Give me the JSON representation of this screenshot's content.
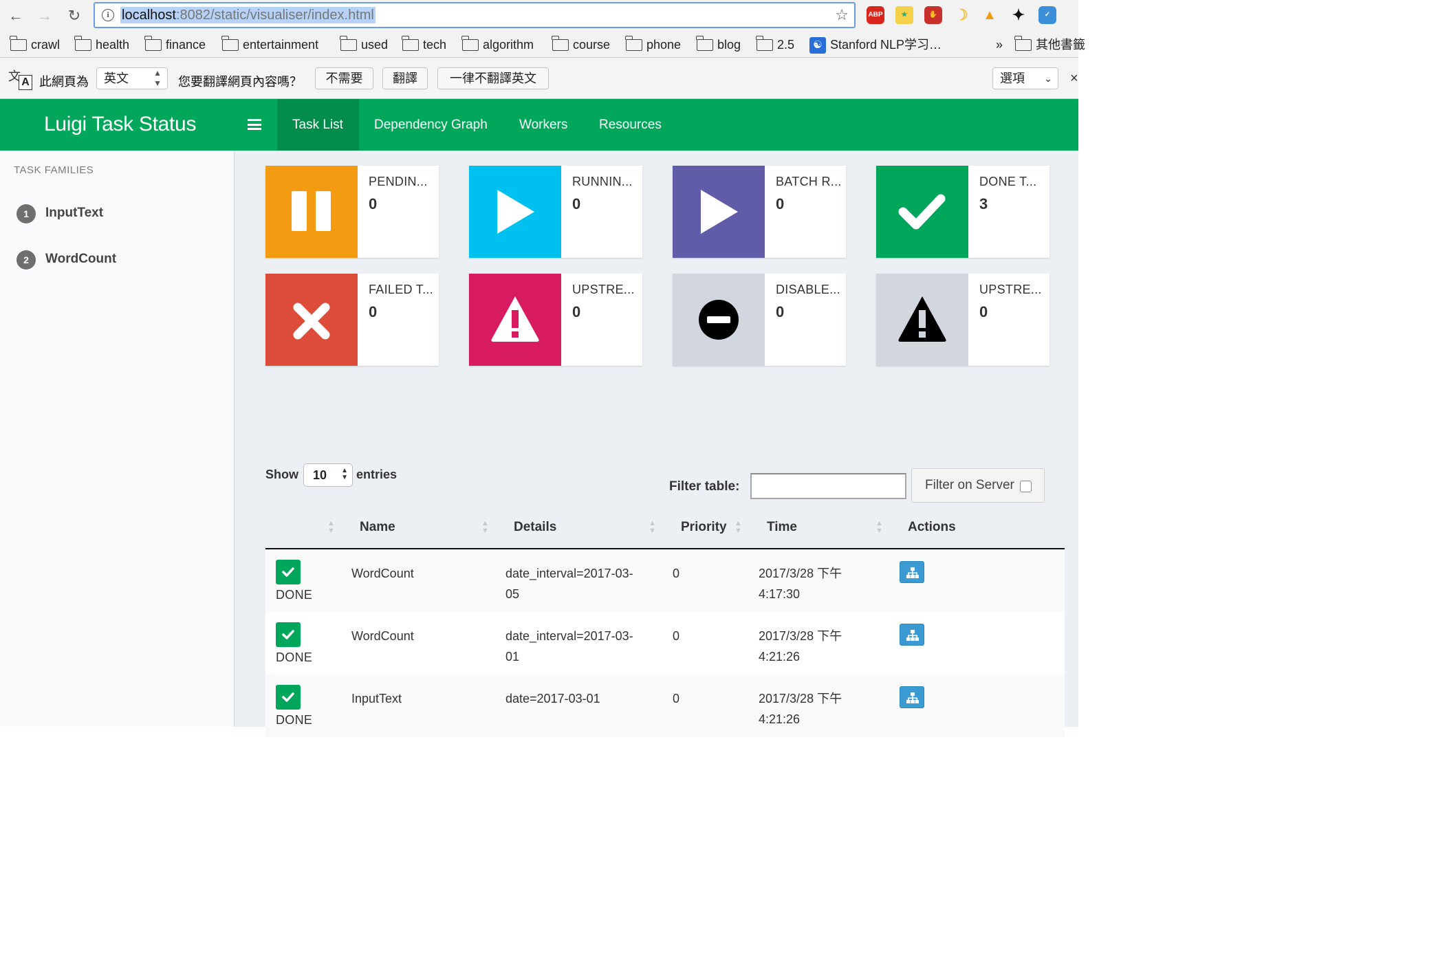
{
  "browser": {
    "url_host": "localhost",
    "url_rest": ":8082/static/visualiser/index.html",
    "bookmarks": [
      "crawl",
      "health",
      "finance",
      "entertainment",
      "used",
      "tech",
      "algorithm",
      "course",
      "phone",
      "blog",
      "2.5",
      "Stanford NLP学习…",
      "其他書籤"
    ],
    "overflow": "»",
    "extensions": [
      "ABP"
    ]
  },
  "translate": {
    "prefix": "此網頁為",
    "language": "英文",
    "question": "您要翻譯網頁內容嗎？",
    "no": "不需要",
    "translate": "翻譯",
    "never": "一律不翻譯英文",
    "options": "選項"
  },
  "app": {
    "brand": "Luigi Task Status",
    "nav": [
      "Task List",
      "Dependency Graph",
      "Workers",
      "Resources"
    ],
    "active_nav": "Task List",
    "accent": "#00a65a"
  },
  "sidebar": {
    "heading": "TASK FAMILIES",
    "families": [
      {
        "num": "1",
        "name": "InputText"
      },
      {
        "num": "2",
        "name": "WordCount"
      }
    ]
  },
  "status_boxes": [
    {
      "label": "PENDIN...",
      "count": "0",
      "color": "#f39c12",
      "icon": "pause-icon"
    },
    {
      "label": "RUNNIN...",
      "count": "0",
      "color": "#00c0ef",
      "icon": "play-icon"
    },
    {
      "label": "BATCH R...",
      "count": "0",
      "color": "#605ca8",
      "icon": "play-icon"
    },
    {
      "label": "DONE T...",
      "count": "3",
      "color": "#00a65a",
      "icon": "check-icon"
    },
    {
      "label": "FAILED T...",
      "count": "0",
      "color": "#dd4b39",
      "icon": "x-icon"
    },
    {
      "label": "UPSTRE...",
      "count": "0",
      "color": "#d81b60",
      "icon": "warning-icon"
    },
    {
      "label": "DISABLE...",
      "count": "0",
      "color": "#d2d6de",
      "icon": "minus-circle-icon"
    },
    {
      "label": "UPSTRE...",
      "count": "0",
      "color": "#d2d6de",
      "icon": "warning-icon"
    }
  ],
  "table_controls": {
    "show": "Show",
    "length": "10",
    "entries": "entries",
    "filter_label": "Filter table:",
    "filter_value": "",
    "filter_server": "Filter on Server"
  },
  "table": {
    "headers": [
      "Name",
      "Details",
      "Priority",
      "Time",
      "Actions"
    ],
    "rows": [
      {
        "status": "DONE",
        "name": "WordCount",
        "details_1": "date_interval=2017-03-",
        "details_2": "05",
        "priority": "0",
        "time_1": "2017/3/28 下午",
        "time_2": "4:17:30"
      },
      {
        "status": "DONE",
        "name": "WordCount",
        "details_1": "date_interval=2017-03-",
        "details_2": "01",
        "priority": "0",
        "time_1": "2017/3/28 下午",
        "time_2": "4:21:26"
      },
      {
        "status": "DONE",
        "name": "InputText",
        "details_1": "date=2017-03-01",
        "details_2": "",
        "priority": "0",
        "time_1": "2017/3/28 下午",
        "time_2": "4:21:26"
      }
    ]
  }
}
